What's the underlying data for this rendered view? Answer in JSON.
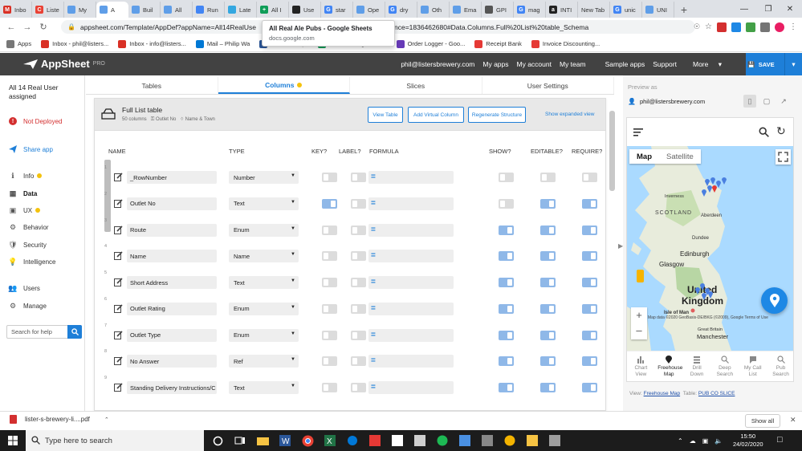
{
  "browser": {
    "tabs": [
      {
        "label": "Inbo",
        "color": "#d93025",
        "glyph": "M"
      },
      {
        "label": "Liste",
        "color": "#e94235",
        "glyph": "C"
      },
      {
        "label": "My",
        "color": "#5f9ee8",
        "glyph": ""
      },
      {
        "label": "A",
        "color": "#5f9ee8",
        "glyph": "",
        "active": true
      },
      {
        "label": "Buil",
        "color": "#5f9ee8",
        "glyph": ""
      },
      {
        "label": "All",
        "color": "#5f9ee8",
        "glyph": ""
      },
      {
        "label": "Run",
        "color": "#4285f4",
        "glyph": ""
      },
      {
        "label": "Late",
        "color": "#34a7e0",
        "glyph": ""
      },
      {
        "label": "All I",
        "color": "#0f9d58",
        "glyph": "+"
      },
      {
        "label": "Use",
        "color": "#222",
        "glyph": ""
      },
      {
        "label": "star",
        "color": "#4285f4",
        "glyph": "G"
      },
      {
        "label": "Ope",
        "color": "#5f9ee8",
        "glyph": ""
      },
      {
        "label": "dry",
        "color": "#4285f4",
        "glyph": "G"
      },
      {
        "label": "Oth",
        "color": "#5f9ee8",
        "glyph": ""
      },
      {
        "label": "Ema",
        "color": "#5f9ee8",
        "glyph": ""
      },
      {
        "label": "GPI",
        "color": "#555",
        "glyph": ""
      },
      {
        "label": "mag",
        "color": "#4285f4",
        "glyph": "G"
      },
      {
        "label": "INTI",
        "color": "#222",
        "glyph": "a"
      },
      {
        "label": "New Tab",
        "color": "",
        "glyph": ""
      },
      {
        "label": "unic",
        "color": "#4285f4",
        "glyph": "G"
      },
      {
        "label": "UNI",
        "color": "#5f9ee8",
        "glyph": ""
      }
    ],
    "url": "appsheet.com/Template/AppDef?appName=All14RealUse",
    "url_tail": "nce=1836462680#Data.Columns.Full%20List%20table_Schema",
    "bookmarks": [
      {
        "label": "Apps",
        "color": "#777"
      },
      {
        "label": "Inbox - phil@listers...",
        "color": "#d93025"
      },
      {
        "label": "Inbox - info@listers...",
        "color": "#d93025"
      },
      {
        "label": "Mail – Philip Wa",
        "color": "#0078d4"
      },
      {
        "label": "Dashboard |...",
        "color": "#2b579a"
      },
      {
        "label": "Stock - Google She...",
        "color": "#0f9d58"
      },
      {
        "label": "Order Logger - Goo...",
        "color": "#673ab7"
      },
      {
        "label": "Receipt Bank",
        "color": "#e53935"
      },
      {
        "label": "Invoice Discounting...",
        "color": "#e53935"
      }
    ],
    "tooltip": {
      "title": "All Real Ale Pubs - Google Sheets",
      "domain": "docs.google.com"
    }
  },
  "header": {
    "logo": "AppSheet",
    "pro": "PRO",
    "email": "phil@listersbrewery.com",
    "links": [
      "My apps",
      "My account",
      "My team",
      "Sample apps",
      "Support",
      "More"
    ],
    "save": "SAVE"
  },
  "sidebar": {
    "app_name": "All 14 Real User assigned",
    "status": "Not Deployed",
    "share": "Share app",
    "items": [
      "Info",
      "Data",
      "UX",
      "Behavior",
      "Security",
      "Intelligence",
      "Users",
      "Manage"
    ],
    "search_placeholder": "Search for help"
  },
  "main_tabs": [
    "Tables",
    "Columns",
    "Slices",
    "User Settings"
  ],
  "table": {
    "name": "Full List table",
    "meta_columns": "50 columns",
    "meta_key": "Outlet No",
    "meta_label": "Name & Town",
    "buttons": [
      "View Table",
      "Add Virtual Column",
      "Regenerate Structure"
    ],
    "show_expanded": "Show expanded view",
    "headers": [
      "NAME",
      "TYPE",
      "KEY?",
      "LABEL?",
      "FORMULA",
      "SHOW?",
      "EDITABLE?",
      "REQUIRE?"
    ],
    "formula_glyph": "=",
    "rows": [
      {
        "num": "1",
        "name": "_RowNumber",
        "type": "Number",
        "key": false,
        "label": false,
        "show": false,
        "editable": false,
        "required": false
      },
      {
        "num": "2",
        "name": "Outlet No",
        "type": "Text",
        "key": true,
        "label": false,
        "show": false,
        "editable": true,
        "required": true
      },
      {
        "num": "3",
        "name": "Route",
        "type": "Enum",
        "key": false,
        "label": false,
        "show": true,
        "editable": true,
        "required": true
      },
      {
        "num": "4",
        "name": "Name",
        "type": "Name",
        "key": false,
        "label": false,
        "show": true,
        "editable": true,
        "required": true
      },
      {
        "num": "5",
        "name": "Short Address",
        "type": "Text",
        "key": false,
        "label": false,
        "show": true,
        "editable": true,
        "required": true
      },
      {
        "num": "6",
        "name": "Outlet Rating",
        "type": "Enum",
        "key": false,
        "label": false,
        "show": true,
        "editable": true,
        "required": true
      },
      {
        "num": "7",
        "name": "Outlet Type",
        "type": "Enum",
        "key": false,
        "label": false,
        "show": true,
        "editable": true,
        "required": true
      },
      {
        "num": "8",
        "name": "No Answer",
        "type": "Ref",
        "key": false,
        "label": false,
        "show": true,
        "editable": true,
        "required": true
      },
      {
        "num": "9",
        "name": "Standing Delivery Instructions/C",
        "type": "Text",
        "key": false,
        "label": false,
        "show": true,
        "editable": true,
        "required": true
      }
    ]
  },
  "preview": {
    "label": "Preview as",
    "email": "phil@listersbrewery.com",
    "map_tabs": [
      "Map",
      "Satellite"
    ],
    "map_places": [
      "Inverness",
      "Aberdeen",
      "SCOTLAND",
      "Dundee",
      "Edinburgh",
      "Glasgow",
      "United",
      "Kingdom",
      "Isle of Man",
      "Great Britain",
      "Manchester"
    ],
    "attribution": "Map data ©2020 GeoBasis-DE/BKG (©2009), Google   Terms of Use",
    "nav": [
      "Chart View",
      "Freehouse Map",
      "Drill Down",
      "Deep Search",
      "My Call List",
      "Pub Search"
    ],
    "view_label": "View:",
    "view_value": "Freehouse Map",
    "table_label": "Table:",
    "table_value": "PUB CO SLICE"
  },
  "downloads": {
    "file": "lister-s-brewery-li....pdf",
    "show_all": "Show all"
  },
  "taskbar": {
    "search": "Type here to search",
    "time": "15:50",
    "date": "24/02/2020"
  }
}
